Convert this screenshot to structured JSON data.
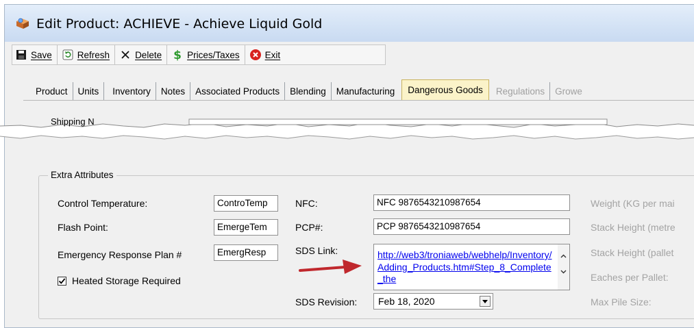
{
  "window": {
    "title": "Edit Product: ACHIEVE - Achieve Liquid Gold"
  },
  "toolbar": {
    "save_label": "Save",
    "refresh_label": "Refresh",
    "delete_label": "Delete",
    "prices_label": "Prices/Taxes",
    "exit_label": "Exit"
  },
  "tabs": [
    {
      "label": "Product"
    },
    {
      "label": "Units"
    },
    {
      "label": "Inventory"
    },
    {
      "label": "Notes"
    },
    {
      "label": "Associated Products"
    },
    {
      "label": "Blending"
    },
    {
      "label": "Manufacturing"
    },
    {
      "label": "Dangerous Goods",
      "active": true
    },
    {
      "label": "Regulations",
      "disabled": true
    },
    {
      "label": "Growe",
      "disabled": true
    }
  ],
  "shipping_label_partial": "Shipping N",
  "extra_attributes": {
    "legend": "Extra Attributes",
    "control_temperature": {
      "label": "Control Temperature:",
      "value": "ControTemp"
    },
    "flash_point": {
      "label": "Flash Point:",
      "value": "EmergeTem"
    },
    "emergency_plan": {
      "label": "Emergency Response Plan #",
      "value": "EmergResp"
    },
    "heated_storage": {
      "label": "Heated Storage Required",
      "checked": true
    },
    "nfc": {
      "label": "NFC:",
      "value": "NFC 9876543210987654"
    },
    "pcp": {
      "label": "PCP#:",
      "value": "PCP 9876543210987654"
    },
    "sds_link": {
      "label": "SDS Link:",
      "value": "http://web3/troniaweb/webhelp/Inventory/Adding_Products.htm#Step_8_Complete_the"
    },
    "sds_revision": {
      "label": "SDS Revision:",
      "value": "Feb 18, 2020"
    },
    "weight": {
      "label": "Weight (KG per mai"
    },
    "stack_height_m": {
      "label": "Stack Height (metre"
    },
    "stack_height_p": {
      "label": "Stack Height (pallet"
    },
    "eaches_per_pallet": {
      "label": "Eaches per Pallet:"
    },
    "max_pile_size": {
      "label": "Max Pile Size:"
    }
  },
  "colors": {
    "active_tab": "#fbf3c9",
    "link": "#0000ee",
    "arrow": "#c0282d",
    "titlebar": "#d3e2f5"
  }
}
